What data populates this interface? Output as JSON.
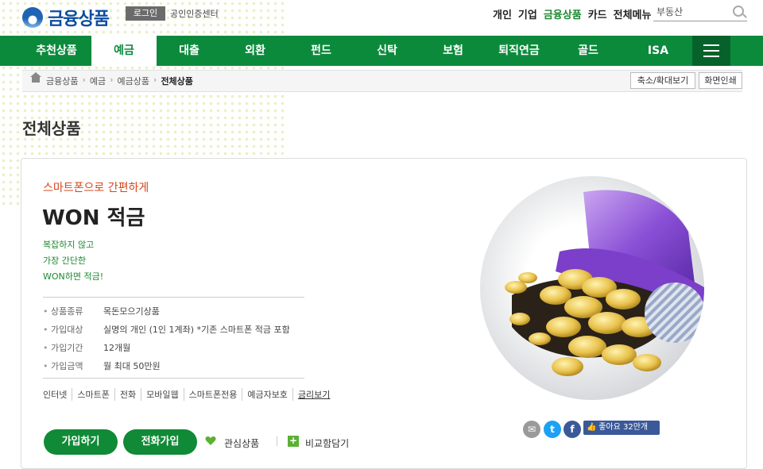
{
  "header": {
    "logo_text": "금융상품",
    "login_label": "로그인",
    "cert_label": "공인인증센터",
    "top_nav": [
      "개인",
      "기업",
      "금융상품",
      "카드",
      "전체메뉴"
    ],
    "active_top_nav": "금융상품",
    "search_value": "부동산"
  },
  "main_nav": {
    "items": [
      "추천상품",
      "예금",
      "대출",
      "외환",
      "펀드",
      "신탁",
      "보험",
      "퇴직연금",
      "골드",
      "ISA"
    ],
    "active": "예금"
  },
  "breadcrumb": {
    "items": [
      "금융상품",
      "예금",
      "예금상품",
      "전체상품"
    ],
    "zoom_label": "축소/확대보기",
    "print_label": "화면인쇄"
  },
  "page_title": "전체상품",
  "product": {
    "tagline": "스마트폰으로 간편하게",
    "name": "WON 적금",
    "description": [
      "복잡하지 않고",
      "가장 간단한",
      "WON하면 적금!"
    ],
    "details": [
      {
        "label": "상품종류",
        "value": "목돈모으기상품"
      },
      {
        "label": "가입대상",
        "value": "실명의 개인 (1인 1계좌) *기존 스마트폰 적금 포함"
      },
      {
        "label": "가입기간",
        "value": "12개월"
      },
      {
        "label": "가입금액",
        "value": "월 최대 50만원"
      }
    ],
    "channels": [
      "인터넷",
      "스마트폰",
      "전화",
      "모바일웹",
      "스마트폰전용",
      "예금자보호",
      "금리보기"
    ],
    "join_button": "가입하기",
    "phone_join_button": "전화가입",
    "wishlist_label": "관심상품",
    "compare_label": "비교함담기"
  },
  "social": {
    "like_label": "좋아요 32만개",
    "icons": [
      "email-icon",
      "twitter-icon",
      "facebook-icon"
    ]
  },
  "colors": {
    "brand_green": "#0c8a3c",
    "logo_blue": "#0c4da2",
    "tagline_red": "#d4471b",
    "facebook_blue": "#3b5998"
  }
}
